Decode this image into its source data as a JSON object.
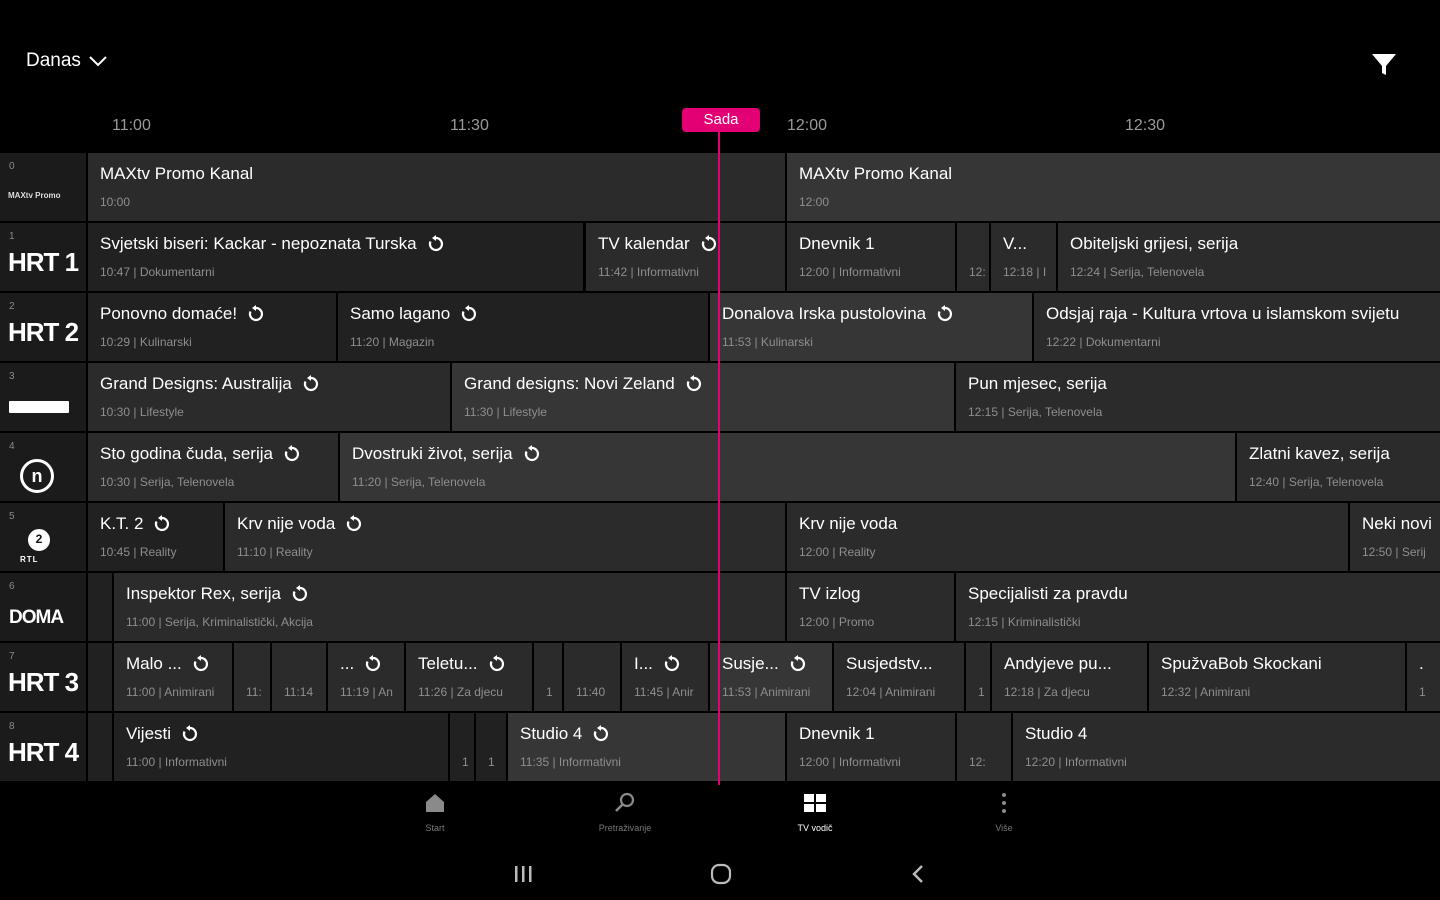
{
  "header": {
    "day_label": "Danas",
    "filter_icon": "filter-icon"
  },
  "timeline": {
    "ticks": [
      "11:00",
      "11:30",
      "12:00",
      "12:30"
    ],
    "now_label": "Sada"
  },
  "colors": {
    "accent": "#e20074",
    "cell_dark": "#212121",
    "cell_mid": "#2b2b2b",
    "cell_light": "#363636"
  },
  "channels": [
    {
      "num": "0",
      "logo": "MAXtv Promo"
    },
    {
      "num": "1",
      "logo": "HRT 1"
    },
    {
      "num": "2",
      "logo": "HRT 2"
    },
    {
      "num": "3",
      "logo": ""
    },
    {
      "num": "4",
      "logo": "n"
    },
    {
      "num": "5",
      "logo": "2",
      "logo_sub": "RTL"
    },
    {
      "num": "6",
      "logo": "DOMA"
    },
    {
      "num": "7",
      "logo": "HRT 3"
    },
    {
      "num": "8",
      "logo": "HRT 4"
    }
  ],
  "rows": [
    [
      {
        "title": "MAXtv Promo Kanal",
        "sub": "10:00"
      },
      {
        "title": "MAXtv Promo Kanal",
        "sub": "12:00"
      }
    ],
    [
      {
        "title": "Svjetski biseri: Kackar - nepoznata Turska",
        "sub": "10:47 | Dokumentarni"
      },
      {
        "title": "TV kalendar",
        "sub": "11:42 | Informativni"
      },
      {
        "title": "Dnevnik 1",
        "sub": "12:00 | Informativni"
      },
      {
        "title": "",
        "sub": "12:"
      },
      {
        "title": "V...",
        "sub": "12:18 | I"
      },
      {
        "title": "Obiteljski grijesi, serija",
        "sub": "12:24 | Serija, Telenovela"
      }
    ],
    [
      {
        "title": "Ponovno domaće!",
        "sub": "10:29 | Kulinarski"
      },
      {
        "title": "Samo lagano",
        "sub": "11:20 | Magazin"
      },
      {
        "title": "Donalova Irska pustolovina",
        "sub": "11:53 | Kulinarski"
      },
      {
        "title": "Odsjaj raja - Kultura vrtova u islamskom svijetu",
        "sub": "12:22 | Dokumentarni"
      }
    ],
    [
      {
        "title": "Grand Designs: Australija",
        "sub": "10:30 | Lifestyle"
      },
      {
        "title": "Grand designs: Novi Zeland",
        "sub": "11:30 | Lifestyle"
      },
      {
        "title": "Pun mjesec, serija",
        "sub": "12:15 | Serija, Telenovela"
      }
    ],
    [
      {
        "title": "Sto godina čuda, serija",
        "sub": "10:30 | Serija, Telenovela"
      },
      {
        "title": "Dvostruki život, serija",
        "sub": "11:20 | Serija, Telenovela"
      },
      {
        "title": "Zlatni kavez, serija",
        "sub": "12:40 | Serija, Telenovela"
      }
    ],
    [
      {
        "title": "K.T. 2",
        "sub": "10:45 | Reality"
      },
      {
        "title": "Krv nije voda",
        "sub": "11:10 | Reality"
      },
      {
        "title": "Krv nije voda",
        "sub": "12:00 | Reality"
      },
      {
        "title": "Neki novi",
        "sub": "12:50 | Serij"
      }
    ],
    [
      {
        "title": "",
        "sub": ""
      },
      {
        "title": "Inspektor Rex, serija",
        "sub": "11:00 | Serija, Kriminalistički, Akcija"
      },
      {
        "title": "TV izlog",
        "sub": "12:00 | Promo"
      },
      {
        "title": "Specijalisti za pravdu",
        "sub": "12:15 | Kriminalistički"
      }
    ],
    [
      {
        "title": "",
        "sub": ""
      },
      {
        "title": "Malo ...",
        "sub": "11:00 | Animirani"
      },
      {
        "title": "",
        "sub": "11:"
      },
      {
        "title": "",
        "sub": "11:14"
      },
      {
        "title": "...",
        "sub": "11:19 | An"
      },
      {
        "title": "Teletu...",
        "sub": "11:26 | Za djecu"
      },
      {
        "title": "",
        "sub": "1"
      },
      {
        "title": "",
        "sub": "11:40"
      },
      {
        "title": "I...",
        "sub": "11:45 | Anir"
      },
      {
        "title": "Susje...",
        "sub": "11:53 | Animirani"
      },
      {
        "title": "Susjedstv...",
        "sub": "12:04 | Animirani"
      },
      {
        "title": "",
        "sub": "1"
      },
      {
        "title": "Andyjeve pu...",
        "sub": "12:18 | Za djecu"
      },
      {
        "title": "SpužvaBob Skockani",
        "sub": "12:32 | Animirani"
      },
      {
        "title": ".",
        "sub": "1"
      }
    ],
    [
      {
        "title": "",
        "sub": ""
      },
      {
        "title": "Vijesti",
        "sub": "11:00 | Informativni"
      },
      {
        "title": "",
        "sub": "1"
      },
      {
        "title": "",
        "sub": "1"
      },
      {
        "title": "Studio 4",
        "sub": "11:35 | Informativni"
      },
      {
        "title": "Dnevnik 1",
        "sub": "12:00 | Informativni"
      },
      {
        "title": "",
        "sub": "12:"
      },
      {
        "title": "Studio 4",
        "sub": "12:20 | Informativni"
      }
    ]
  ],
  "bottom_nav": {
    "items": [
      {
        "label": "Start",
        "icon": "home-icon"
      },
      {
        "label": "Pretraživanje",
        "icon": "search-icon"
      },
      {
        "label": "TV vodič",
        "icon": "tv-guide-icon"
      },
      {
        "label": "Više",
        "icon": "more-icon"
      }
    ]
  }
}
